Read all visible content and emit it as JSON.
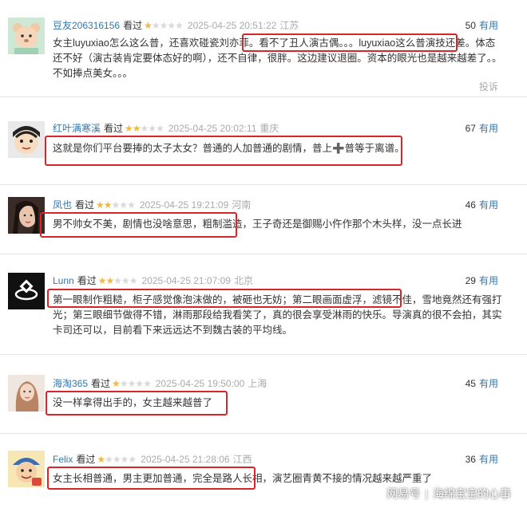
{
  "reviews": [
    {
      "user": "豆友206316156",
      "watched": "看过",
      "rating": 1,
      "time": "2025-04-25 20:51:22",
      "location": "江苏",
      "votes": "50",
      "useful": "有用",
      "text": "女主luyuxiao怎么这么普，还喜欢碰瓷刘亦菲。看不了丑人演古偶。。。luyuxiao这么普演技还差。体态还不好（演古装肯定要体态好的啊），还不自律，很胖。这边建议退圈。资本的眼光也是越来越差了。。不如捧点美女。。。",
      "report": "投诉"
    },
    {
      "user": "红叶满寒溪",
      "watched": "看过",
      "rating": 2,
      "time": "2025-04-25 20:02:11",
      "location": "重庆",
      "votes": "67",
      "useful": "有用",
      "text": "这就是你们平台要捧的太子太女？普通的人加普通的剧情，普上➕普等于离谱。"
    },
    {
      "user": "凤也",
      "watched": "看过",
      "rating": 2,
      "time": "2025-04-25 19:21:09",
      "location": "河南",
      "votes": "46",
      "useful": "有用",
      "text": "男不帅女不美，剧情也没啥意思，粗制滥造，王子奇还是御赐小仵作那个木头样，没一点长进"
    },
    {
      "user": "Lunn",
      "watched": "看过",
      "rating": 2,
      "time": "2025-04-25 21:07:09",
      "location": "北京",
      "votes": "29",
      "useful": "有用",
      "text": "第一眼制作粗糙，柜子感觉像泡沫做的，被砸也无妨；第二眼画面虚浮，滤镜不佳，雪地竟然还有强打光；第三眼细节做得不错，淋雨那段给我看笑了，真的很会享受淋雨的快乐。导演真的很不会拍，其实卡司还可以，目前看下来远远达不到魏古装的平均线。"
    },
    {
      "user": "海淘365",
      "watched": "看过",
      "rating": 1,
      "time": "2025-04-25 19:50:00",
      "location": "上海",
      "votes": "45",
      "useful": "有用",
      "text": "没一样拿得出手的，女主越来越普了"
    },
    {
      "user": "Felix",
      "watched": "看过",
      "rating": 1,
      "time": "2025-04-25 21:28:06",
      "location": "江西",
      "votes": "36",
      "useful": "有用",
      "text": "女主长相普通，男主更加普通，完全是路人长相，演艺圈青黄不接的情况越来越严重了"
    }
  ],
  "watermark": {
    "site": "网易号",
    "separator": "|",
    "author": "海绵宝宝的心事"
  },
  "colors": {
    "user_link": "#3377aa",
    "star_on": "#f4b73b",
    "star_off": "#d8d8d8",
    "highlight_box": "#d6252b",
    "meta_gray": "#aaaaaa"
  }
}
